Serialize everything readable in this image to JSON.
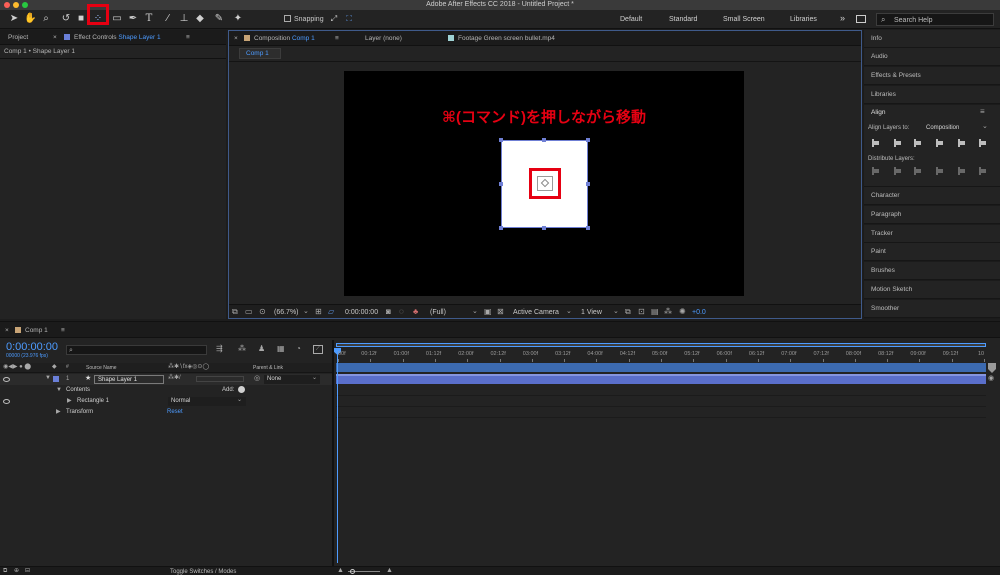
{
  "window": {
    "title": "Adobe After Effects CC 2018 - Untitled Project *"
  },
  "toolbar": {
    "snapping_label": "Snapping",
    "workspaces": [
      "Default",
      "Standard",
      "Small Screen",
      "Libraries"
    ],
    "search_placeholder": "Search Help"
  },
  "project_panel": {
    "tab_project": "Project",
    "tab_effect_prefix": "Effect Controls",
    "tab_effect_layer": "Shape Layer 1",
    "breadcrumb": "Comp 1 • Shape Layer 1"
  },
  "viewer": {
    "tab_composition_prefix": "Composition",
    "tab_composition_name": "Comp 1",
    "tab_layer": "Layer (none)",
    "tab_footage": "Footage Green screen bullet.mp4",
    "comp_subtab": "Comp 1",
    "annotation": "⌘(コマンド)を押しながら移動",
    "bottom": {
      "zoom": "(66.7%)",
      "timecode": "0:00:00:00",
      "resolution": "(Full)",
      "camera": "Active Camera",
      "views": "1 View",
      "exposure": "+0.0"
    }
  },
  "right_panel": {
    "items_top": [
      "Info",
      "Audio",
      "Effects & Presets",
      "Libraries"
    ],
    "align": {
      "title": "Align",
      "align_to_label": "Align Layers to:",
      "align_to_value": "Composition",
      "distribute_label": "Distribute Layers:"
    },
    "items_bottom": [
      "Character",
      "Paragraph",
      "Tracker",
      "Paint",
      "Brushes",
      "Motion Sketch",
      "Smoother"
    ]
  },
  "timeline": {
    "tab": "Comp 1",
    "timecode": "0:00:00:00",
    "fps": "00000 (23.976 fps)",
    "headers": {
      "source_name": "Source Name",
      "parent": "Parent & Link"
    },
    "layer": {
      "number": "1",
      "name": "Shape Layer 1",
      "parent": "None"
    },
    "contents_label": "Contents",
    "add_label": "Add:",
    "rectangle_label": "Rectangle 1",
    "blend_mode": "Normal",
    "transform_label": "Transform",
    "reset_label": "Reset",
    "ruler": [
      "00f",
      "00:12f",
      "01:00f",
      "01:12f",
      "02:00f",
      "02:12f",
      "03:00f",
      "03:12f",
      "04:00f",
      "04:12f",
      "05:00f",
      "05:12f",
      "06:00f",
      "06:12f",
      "07:00f",
      "07:12f",
      "08:00f",
      "08:12f",
      "09:00f",
      "09:12f",
      "10"
    ],
    "toggle_label": "Toggle Switches / Modes"
  },
  "colors": {
    "accent_blue": "#4d9bff",
    "highlight_red": "#e60012",
    "layer_bar": "#5a6fcb",
    "annotation_red": "#e60012"
  }
}
